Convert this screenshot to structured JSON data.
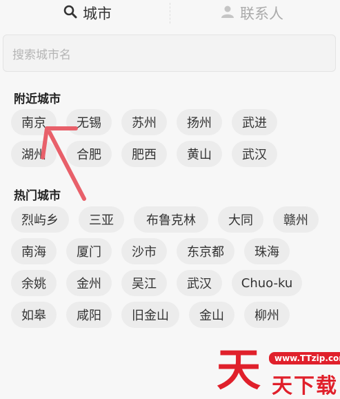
{
  "tabs": {
    "city_label": "城市",
    "contacts_label": "联系人"
  },
  "search": {
    "placeholder": "搜索城市名"
  },
  "nearby": {
    "title": "附近城市",
    "cities": [
      "南京",
      "无锡",
      "苏州",
      "扬州",
      "武进",
      "湖州",
      "合肥",
      "肥西",
      "黄山",
      "武汉"
    ]
  },
  "hot": {
    "title": "热门城市",
    "cities": [
      "烈屿乡",
      "三亚",
      "布鲁克林",
      "大同",
      "赣州",
      "南海",
      "厦门",
      "沙市",
      "东京都",
      "珠海",
      "余姚",
      "金州",
      "吴江",
      "武汉",
      "Chuo-ku",
      "如皋",
      "咸阳",
      "旧金山",
      "金山",
      "柳州"
    ]
  },
  "watermark": {
    "badge": "www.TTzip.com",
    "big_char": "天",
    "text": "天下载"
  },
  "colors": {
    "accent": "#e0202b",
    "arrow": "#e8606a",
    "chip_bg": "#ececec"
  },
  "icons": {
    "city_tab": "search-icon",
    "contacts_tab": "person-icon"
  }
}
